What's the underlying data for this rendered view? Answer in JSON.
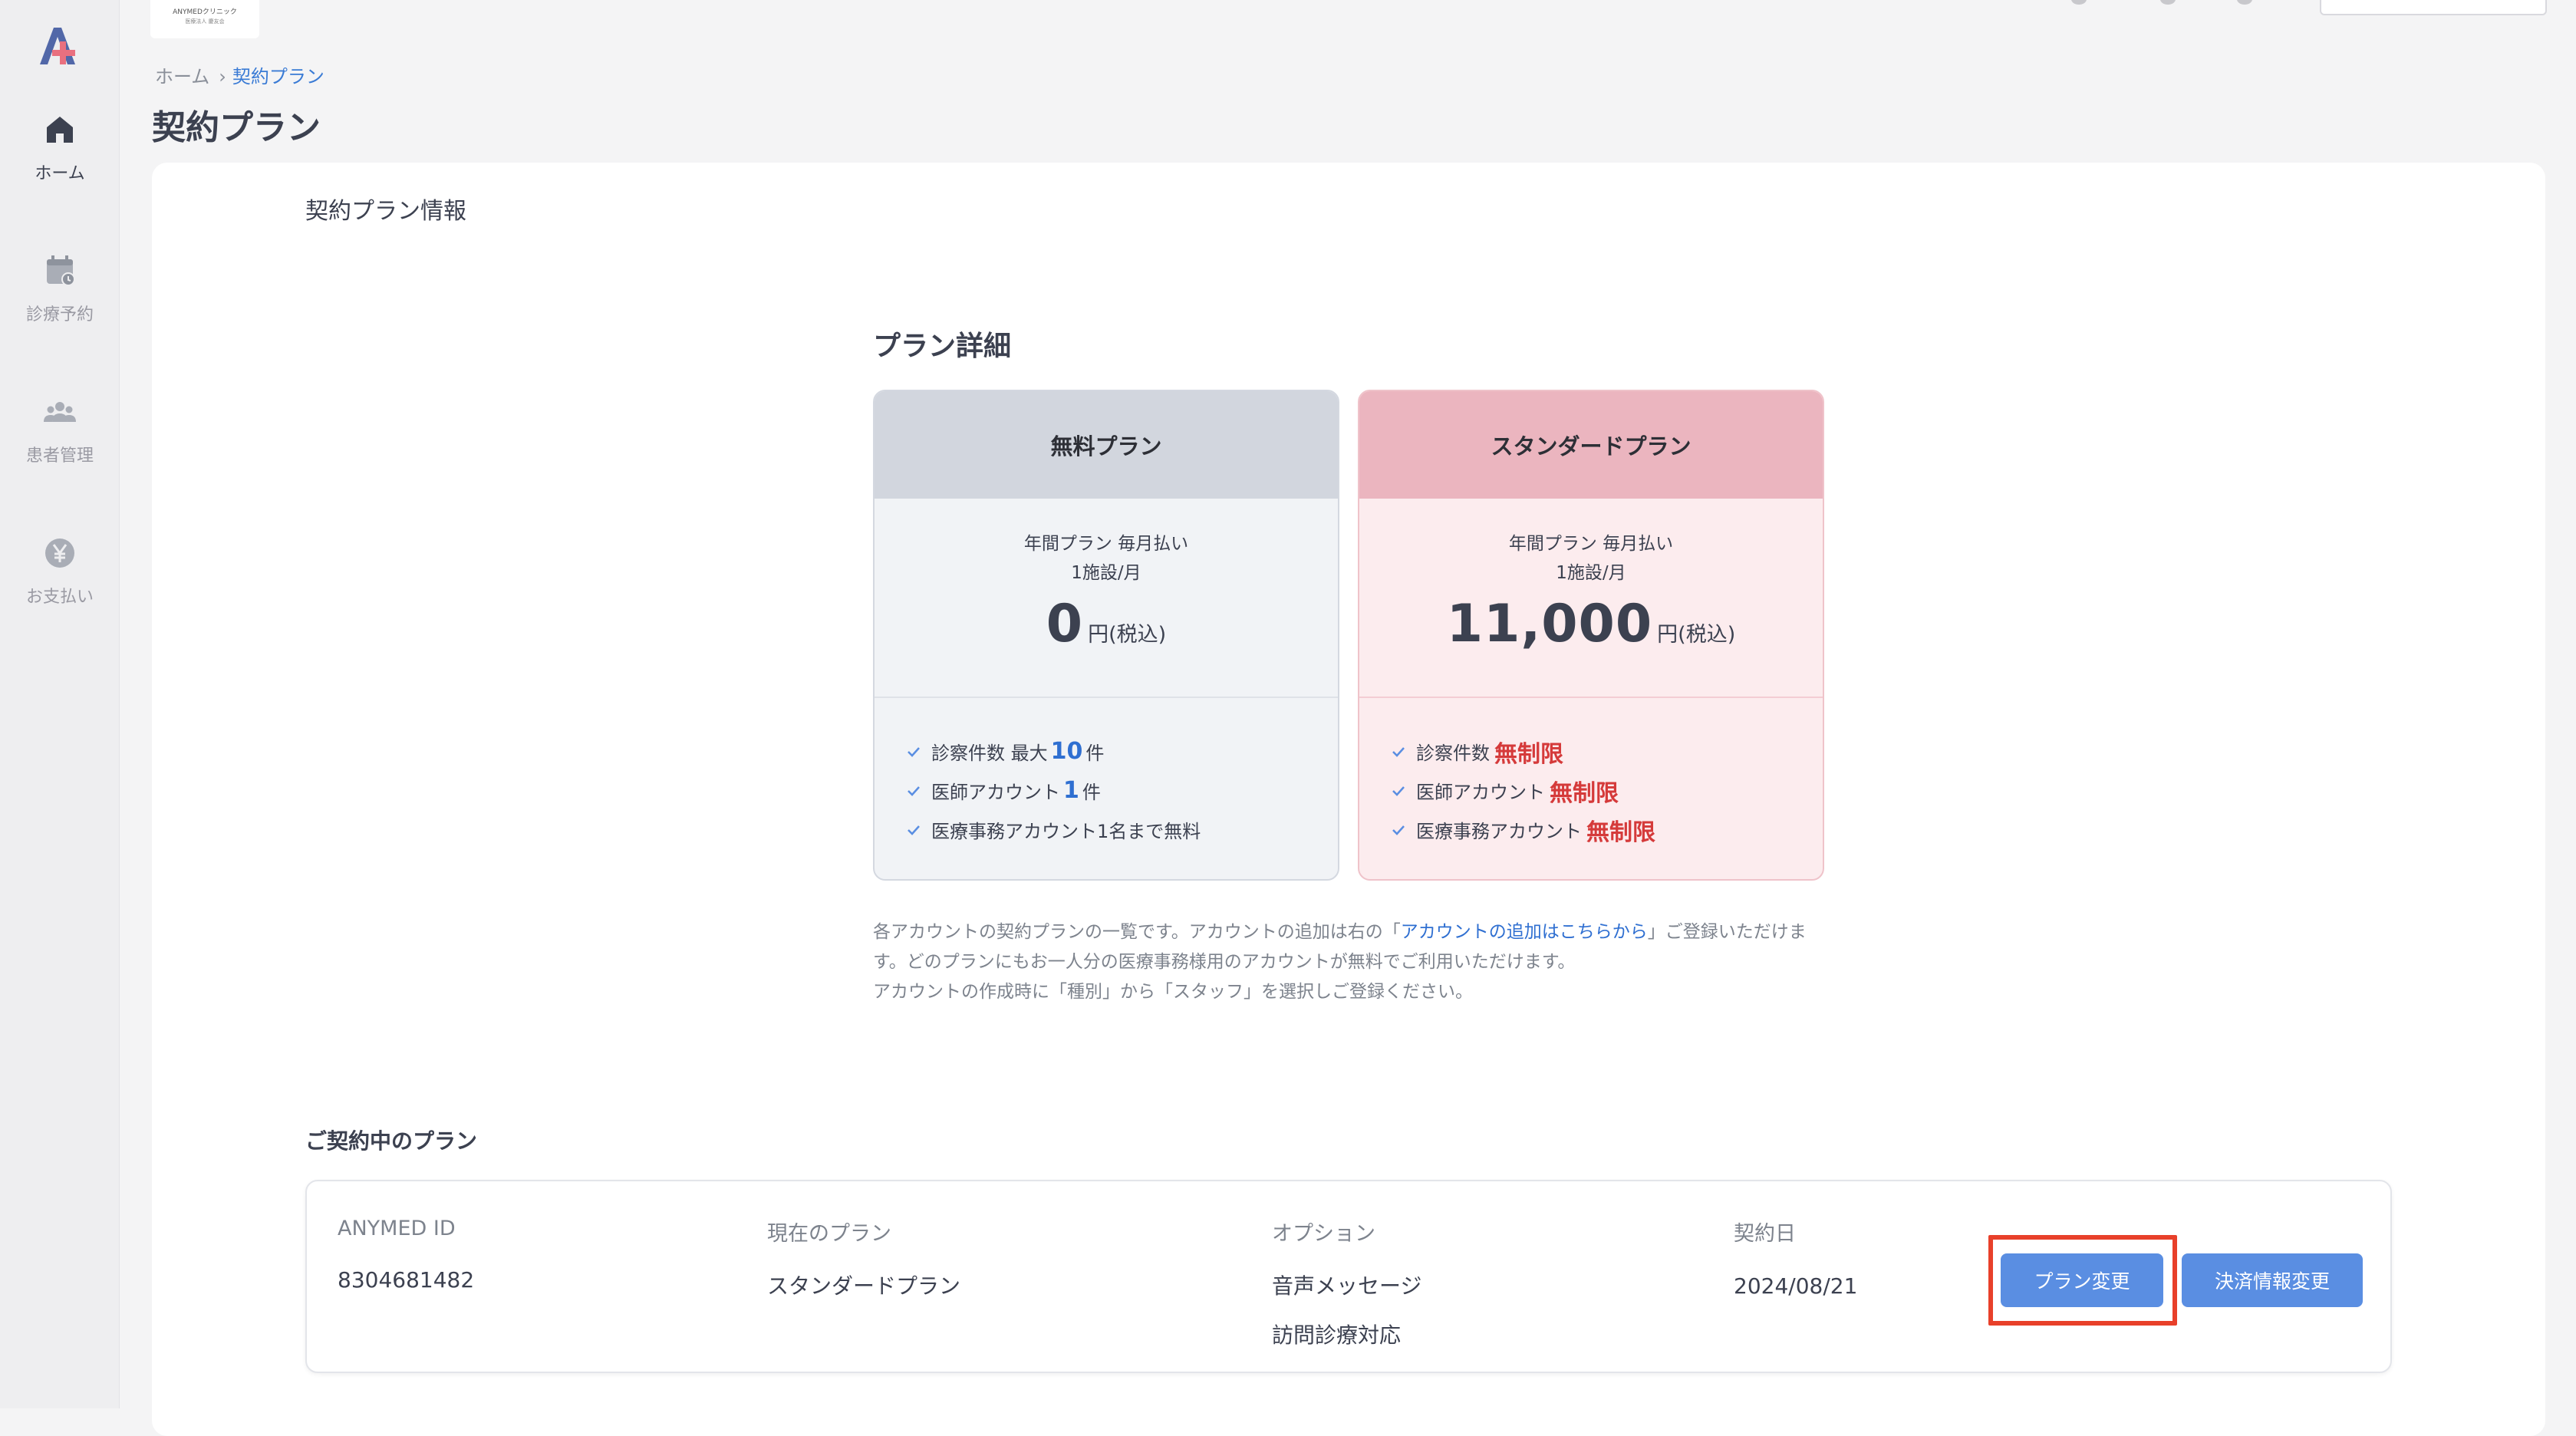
{
  "clinic": {
    "name": "ANYMEDクリニック",
    "sub": "医療法人 慶友会"
  },
  "sidebar": {
    "items": [
      {
        "label": "ホーム",
        "icon": "home-icon",
        "active": true
      },
      {
        "label": "診療予約",
        "icon": "calendar-icon",
        "active": false
      },
      {
        "label": "患者管理",
        "icon": "people-icon",
        "active": false
      },
      {
        "label": "お支払い",
        "icon": "yen-icon",
        "active": false
      }
    ]
  },
  "breadcrumb": {
    "home": "ホーム",
    "separator": "›",
    "current": "契約プラン"
  },
  "page": {
    "title": "契約プラン",
    "section_title": "契約プラン情報",
    "plan_detail_title": "プラン詳細"
  },
  "plans": {
    "free": {
      "name": "無料プラン",
      "billing": "年間プラン 毎月払い",
      "per": "1施設/月",
      "price": "0",
      "price_unit": "円(税込)",
      "features": [
        {
          "prefix": "診察件数 最大",
          "highlight": "10",
          "suffix": "件"
        },
        {
          "prefix": "医師アカウント",
          "highlight": "1",
          "suffix": "件"
        },
        {
          "prefix": "医療事務アカウント1名まで無料",
          "highlight": "",
          "suffix": ""
        }
      ]
    },
    "standard": {
      "name": "スタンダードプラン",
      "billing": "年間プラン 毎月払い",
      "per": "1施設/月",
      "price": "11,000",
      "price_unit": "円(税込)",
      "features": [
        {
          "prefix": "診察件数",
          "highlight": "無制限"
        },
        {
          "prefix": "医師アカウント",
          "highlight": "無制限"
        },
        {
          "prefix": "医療事務アカウント",
          "highlight": "無制限"
        }
      ]
    }
  },
  "notes": {
    "part1": "各アカウントの契約プランの一覧です。アカウントの追加は右の「",
    "link": "アカウントの追加はこちらから",
    "part2": "」ご登録いただけます。どのプランにもお一人分の医療事務様用のアカウントが無料でご利用いただけます。",
    "line2": "アカウントの作成時に「種別」から「スタッフ」を選択しご登録ください。"
  },
  "current_plan": {
    "title": "ご契約中のプラン",
    "id_label": "ANYMED ID",
    "id_value": "8304681482",
    "plan_label": "現在のプラン",
    "plan_value": "スタンダードプラン",
    "option_label": "オプション",
    "options": [
      "音声メッセージ",
      "訪問診療対応"
    ],
    "date_label": "契約日",
    "date_value": "2024/08/21",
    "plan_change_button": "プラン変更",
    "payment_change_button": "決済情報変更"
  },
  "colors": {
    "accent": "#5a8ee2",
    "highlight_red": "#d53a3a",
    "link_blue": "#2f6fd1",
    "annotation_border": "#e8402a"
  }
}
